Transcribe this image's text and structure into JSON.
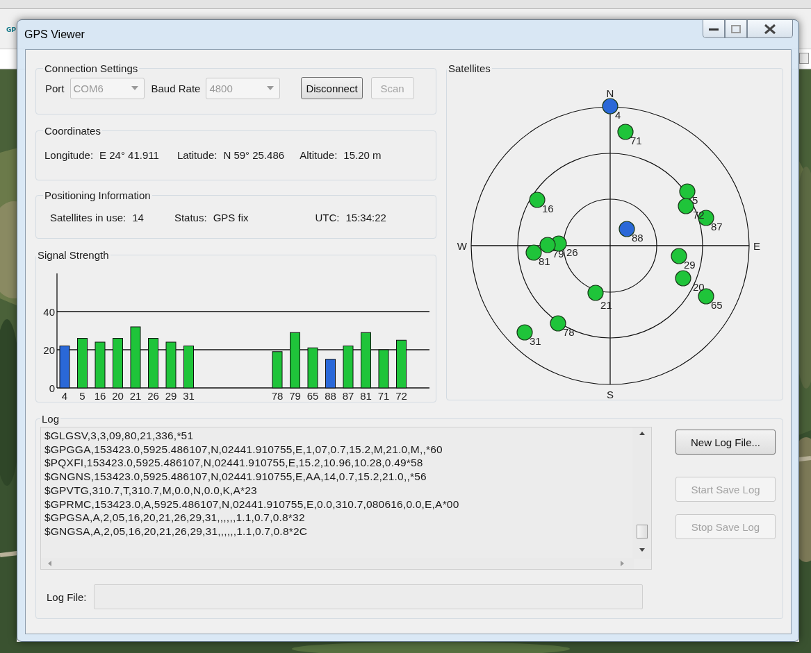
{
  "host": {
    "toolbar_label": "GP"
  },
  "window": {
    "title": "GPS Viewer"
  },
  "connection": {
    "title": "Connection Settings",
    "port_label": "Port",
    "port": {
      "value": "COM6",
      "disabled": true
    },
    "baud_label": "Baud Rate",
    "baud": {
      "value": "4800",
      "disabled": true
    },
    "buttons": [
      {
        "label": "Disconnect",
        "disabled": false
      },
      {
        "label": "Scan",
        "disabled": true
      }
    ]
  },
  "coordinates": {
    "title": "Coordinates",
    "fields": [
      {
        "label": "Longitude:",
        "value": "E 24° 41.911"
      },
      {
        "label": "Latitude:",
        "value": "N 59° 25.486"
      },
      {
        "label": "Altitude:",
        "value": "15.20 m"
      }
    ]
  },
  "positioning": {
    "title": "Positioning Information",
    "fields": [
      {
        "label": "Satellites in use:",
        "value": "14"
      },
      {
        "label": "Status:",
        "value": "GPS fix"
      },
      {
        "label": "UTC:",
        "value": "15:34:22"
      }
    ]
  },
  "signal": {
    "title": "Signal Strength",
    "chart_data": {
      "type": "bar",
      "categories": [
        "4",
        "5",
        "16",
        "20",
        "21",
        "26",
        "29",
        "31",
        "78",
        "79",
        "65",
        "88",
        "87",
        "81",
        "71",
        "72"
      ],
      "ylim": [
        0,
        60
      ],
      "yticks": [
        0,
        20,
        40
      ],
      "stacked": true,
      "series": [
        {
          "color": "#1fc43a",
          "values": [
            null,
            26,
            24,
            26,
            32,
            26,
            24,
            22,
            19,
            29,
            21,
            null,
            22,
            29,
            20,
            25
          ]
        },
        {
          "color": "#2a68d8",
          "values": [
            22,
            null,
            null,
            null,
            null,
            null,
            null,
            null,
            null,
            null,
            null,
            15,
            null,
            null,
            null,
            null
          ]
        }
      ]
    }
  },
  "satellites": {
    "title": "Satellites",
    "compass": [
      "N",
      "E",
      "S",
      "W"
    ],
    "items": [
      {
        "label": "4",
        "color": "#2a68d8"
      },
      {
        "label": "71",
        "color": "#1fc43a"
      },
      {
        "label": "5",
        "color": "#1fc43a"
      },
      {
        "label": "72",
        "color": "#1fc43a"
      },
      {
        "label": "87",
        "color": "#1fc43a"
      },
      {
        "label": "88",
        "color": "#2a68d8"
      },
      {
        "label": "16",
        "color": "#1fc43a"
      },
      {
        "label": "26",
        "color": "#1fc43a"
      },
      {
        "label": "79",
        "color": "#1fc43a"
      },
      {
        "label": "81",
        "color": "#1fc43a"
      },
      {
        "label": "29",
        "color": "#1fc43a"
      },
      {
        "label": "20",
        "color": "#1fc43a"
      },
      {
        "label": "65",
        "color": "#1fc43a"
      },
      {
        "label": "21",
        "color": "#1fc43a"
      },
      {
        "label": "78",
        "color": "#1fc43a"
      },
      {
        "label": "31",
        "color": "#1fc43a"
      }
    ]
  },
  "log": {
    "title": "Log",
    "lines": [
      "$GLGSV,3,3,09,80,21,336,*51",
      "$GPGGA,153423.0,5925.486107,N,02441.910755,E,1,07,0.7,15.2,M,21.0,M,,*60",
      "$PQXFI,153423.0,5925.486107,N,02441.910755,E,15.2,10.96,10.28,0.49*58",
      "$GNGNS,153423.0,5925.486107,N,02441.910755,E,AA,14,0.7,15.2,21.0,,*56",
      "$GPVTG,310.7,T,310.7,M,0.0,N,0.0,K,A*23",
      "$GPRMC,153423.0,A,5925.486107,N,02441.910755,E,0.0,310.7,080616,0.0,E,A*00",
      "$GPGSA,A,2,05,16,20,21,26,29,31,,,,,,1.1,0.7,0.8*32",
      "$GNGSA,A,2,05,16,20,21,26,29,31,,,,,,1.1,0.7,0.8*2C"
    ],
    "buttons": [
      {
        "label": "New Log File...",
        "disabled": false
      },
      {
        "label": "Start Save Log",
        "disabled": true
      },
      {
        "label": "Stop Save Log",
        "disabled": true
      }
    ],
    "file_label": "Log File:"
  }
}
